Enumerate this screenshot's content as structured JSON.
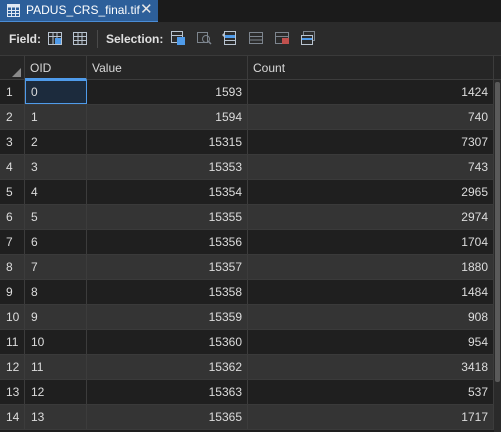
{
  "tab": {
    "title": "PADUS_CRS_final.tif",
    "close_glyph": "✕",
    "icon": "table-icon"
  },
  "toolbar": {
    "field_label": "Field:",
    "selection_label": "Selection:",
    "field_buttons": [
      "add-field-icon",
      "calculate-field-icon"
    ],
    "selection_buttons": [
      "select-by-attributes-icon",
      "zoom-to-selection-icon",
      "switch-selection-icon",
      "clear-selection-icon",
      "delete-selection-icon",
      "copy-selection-icon"
    ]
  },
  "table": {
    "columns": [
      "OID",
      "Value",
      "Count"
    ],
    "rows": [
      {
        "num": "1",
        "oid": "0",
        "value": "1593",
        "count": "1424"
      },
      {
        "num": "2",
        "oid": "1",
        "value": "1594",
        "count": "740"
      },
      {
        "num": "3",
        "oid": "2",
        "value": "15315",
        "count": "7307"
      },
      {
        "num": "4",
        "oid": "3",
        "value": "15353",
        "count": "743"
      },
      {
        "num": "5",
        "oid": "4",
        "value": "15354",
        "count": "2965"
      },
      {
        "num": "6",
        "oid": "5",
        "value": "15355",
        "count": "2974"
      },
      {
        "num": "7",
        "oid": "6",
        "value": "15356",
        "count": "1704"
      },
      {
        "num": "8",
        "oid": "7",
        "value": "15357",
        "count": "1880"
      },
      {
        "num": "9",
        "oid": "8",
        "value": "15358",
        "count": "1484"
      },
      {
        "num": "10",
        "oid": "9",
        "value": "15359",
        "count": "908"
      },
      {
        "num": "11",
        "oid": "10",
        "value": "15360",
        "count": "954"
      },
      {
        "num": "12",
        "oid": "11",
        "value": "15362",
        "count": "3418"
      },
      {
        "num": "13",
        "oid": "12",
        "value": "15363",
        "count": "537"
      },
      {
        "num": "14",
        "oid": "13",
        "value": "15365",
        "count": "1717"
      }
    ]
  },
  "colors": {
    "accent": "#4f9bea",
    "tab_bg": "#2d5f9a",
    "row_even": "#1f1f1f",
    "row_odd": "#343434"
  }
}
